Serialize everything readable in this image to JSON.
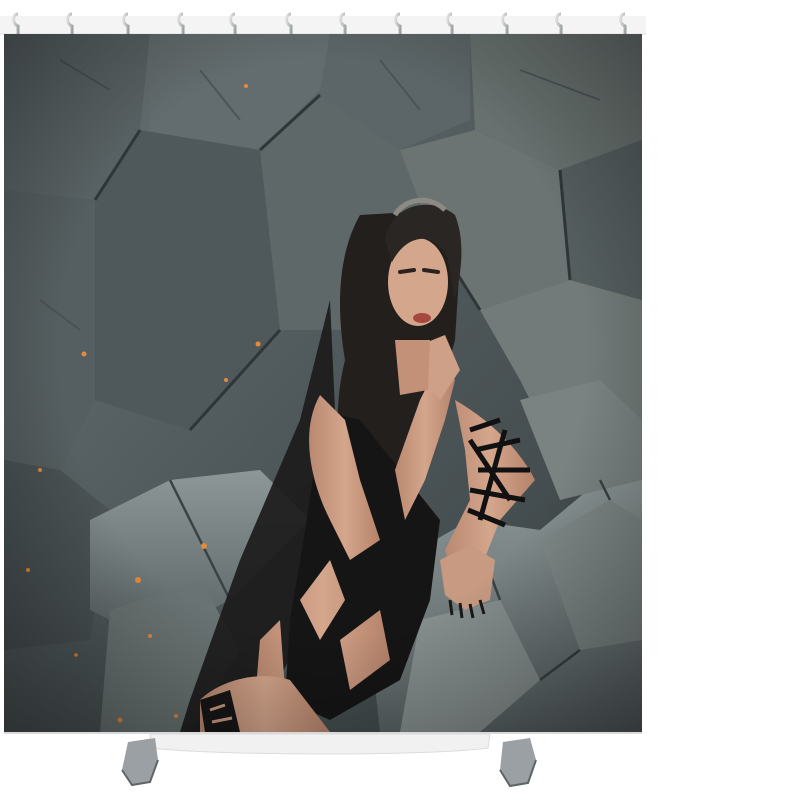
{
  "product": {
    "type": "shower-curtain",
    "hook_count": 12
  },
  "colors": {
    "background": "#ffffff",
    "stone_dark": "#3f4749",
    "stone_mid": "#5d6668",
    "stone_light": "#8a9494",
    "skin": "#c99a80",
    "hair": "#23201e",
    "outfit": "#141414",
    "ember": "#e58a3a",
    "hook_metal": "#b8bcbf"
  }
}
